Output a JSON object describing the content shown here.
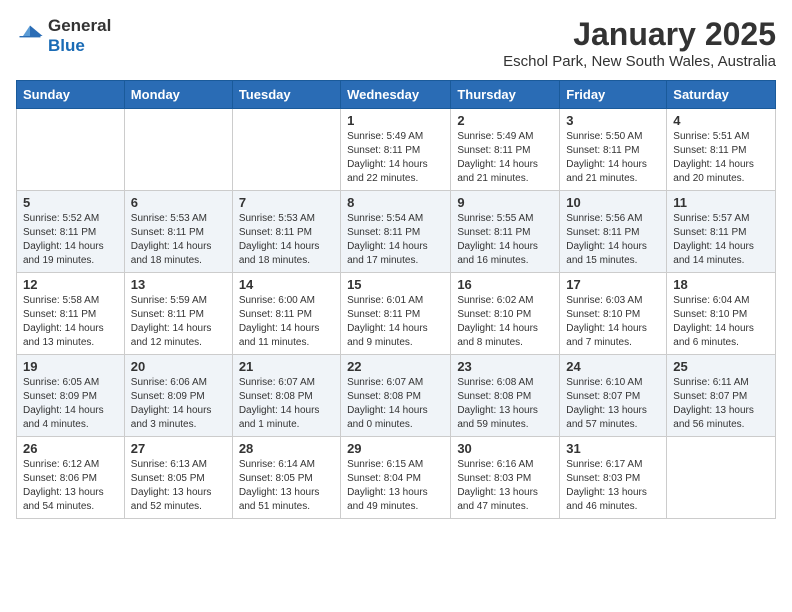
{
  "header": {
    "logo": {
      "general": "General",
      "blue": "Blue"
    },
    "title": "January 2025",
    "location": "Eschol Park, New South Wales, Australia"
  },
  "calendar": {
    "headers": [
      "Sunday",
      "Monday",
      "Tuesday",
      "Wednesday",
      "Thursday",
      "Friday",
      "Saturday"
    ],
    "weeks": [
      [
        {
          "day": "",
          "info": ""
        },
        {
          "day": "",
          "info": ""
        },
        {
          "day": "",
          "info": ""
        },
        {
          "day": "1",
          "info": "Sunrise: 5:49 AM\nSunset: 8:11 PM\nDaylight: 14 hours and 22 minutes."
        },
        {
          "day": "2",
          "info": "Sunrise: 5:49 AM\nSunset: 8:11 PM\nDaylight: 14 hours and 21 minutes."
        },
        {
          "day": "3",
          "info": "Sunrise: 5:50 AM\nSunset: 8:11 PM\nDaylight: 14 hours and 21 minutes."
        },
        {
          "day": "4",
          "info": "Sunrise: 5:51 AM\nSunset: 8:11 PM\nDaylight: 14 hours and 20 minutes."
        }
      ],
      [
        {
          "day": "5",
          "info": "Sunrise: 5:52 AM\nSunset: 8:11 PM\nDaylight: 14 hours and 19 minutes."
        },
        {
          "day": "6",
          "info": "Sunrise: 5:53 AM\nSunset: 8:11 PM\nDaylight: 14 hours and 18 minutes."
        },
        {
          "day": "7",
          "info": "Sunrise: 5:53 AM\nSunset: 8:11 PM\nDaylight: 14 hours and 18 minutes."
        },
        {
          "day": "8",
          "info": "Sunrise: 5:54 AM\nSunset: 8:11 PM\nDaylight: 14 hours and 17 minutes."
        },
        {
          "day": "9",
          "info": "Sunrise: 5:55 AM\nSunset: 8:11 PM\nDaylight: 14 hours and 16 minutes."
        },
        {
          "day": "10",
          "info": "Sunrise: 5:56 AM\nSunset: 8:11 PM\nDaylight: 14 hours and 15 minutes."
        },
        {
          "day": "11",
          "info": "Sunrise: 5:57 AM\nSunset: 8:11 PM\nDaylight: 14 hours and 14 minutes."
        }
      ],
      [
        {
          "day": "12",
          "info": "Sunrise: 5:58 AM\nSunset: 8:11 PM\nDaylight: 14 hours and 13 minutes."
        },
        {
          "day": "13",
          "info": "Sunrise: 5:59 AM\nSunset: 8:11 PM\nDaylight: 14 hours and 12 minutes."
        },
        {
          "day": "14",
          "info": "Sunrise: 6:00 AM\nSunset: 8:11 PM\nDaylight: 14 hours and 11 minutes."
        },
        {
          "day": "15",
          "info": "Sunrise: 6:01 AM\nSunset: 8:11 PM\nDaylight: 14 hours and 9 minutes."
        },
        {
          "day": "16",
          "info": "Sunrise: 6:02 AM\nSunset: 8:10 PM\nDaylight: 14 hours and 8 minutes."
        },
        {
          "day": "17",
          "info": "Sunrise: 6:03 AM\nSunset: 8:10 PM\nDaylight: 14 hours and 7 minutes."
        },
        {
          "day": "18",
          "info": "Sunrise: 6:04 AM\nSunset: 8:10 PM\nDaylight: 14 hours and 6 minutes."
        }
      ],
      [
        {
          "day": "19",
          "info": "Sunrise: 6:05 AM\nSunset: 8:09 PM\nDaylight: 14 hours and 4 minutes."
        },
        {
          "day": "20",
          "info": "Sunrise: 6:06 AM\nSunset: 8:09 PM\nDaylight: 14 hours and 3 minutes."
        },
        {
          "day": "21",
          "info": "Sunrise: 6:07 AM\nSunset: 8:08 PM\nDaylight: 14 hours and 1 minute."
        },
        {
          "day": "22",
          "info": "Sunrise: 6:07 AM\nSunset: 8:08 PM\nDaylight: 14 hours and 0 minutes."
        },
        {
          "day": "23",
          "info": "Sunrise: 6:08 AM\nSunset: 8:08 PM\nDaylight: 13 hours and 59 minutes."
        },
        {
          "day": "24",
          "info": "Sunrise: 6:10 AM\nSunset: 8:07 PM\nDaylight: 13 hours and 57 minutes."
        },
        {
          "day": "25",
          "info": "Sunrise: 6:11 AM\nSunset: 8:07 PM\nDaylight: 13 hours and 56 minutes."
        }
      ],
      [
        {
          "day": "26",
          "info": "Sunrise: 6:12 AM\nSunset: 8:06 PM\nDaylight: 13 hours and 54 minutes."
        },
        {
          "day": "27",
          "info": "Sunrise: 6:13 AM\nSunset: 8:05 PM\nDaylight: 13 hours and 52 minutes."
        },
        {
          "day": "28",
          "info": "Sunrise: 6:14 AM\nSunset: 8:05 PM\nDaylight: 13 hours and 51 minutes."
        },
        {
          "day": "29",
          "info": "Sunrise: 6:15 AM\nSunset: 8:04 PM\nDaylight: 13 hours and 49 minutes."
        },
        {
          "day": "30",
          "info": "Sunrise: 6:16 AM\nSunset: 8:03 PM\nDaylight: 13 hours and 47 minutes."
        },
        {
          "day": "31",
          "info": "Sunrise: 6:17 AM\nSunset: 8:03 PM\nDaylight: 13 hours and 46 minutes."
        },
        {
          "day": "",
          "info": ""
        }
      ]
    ]
  }
}
